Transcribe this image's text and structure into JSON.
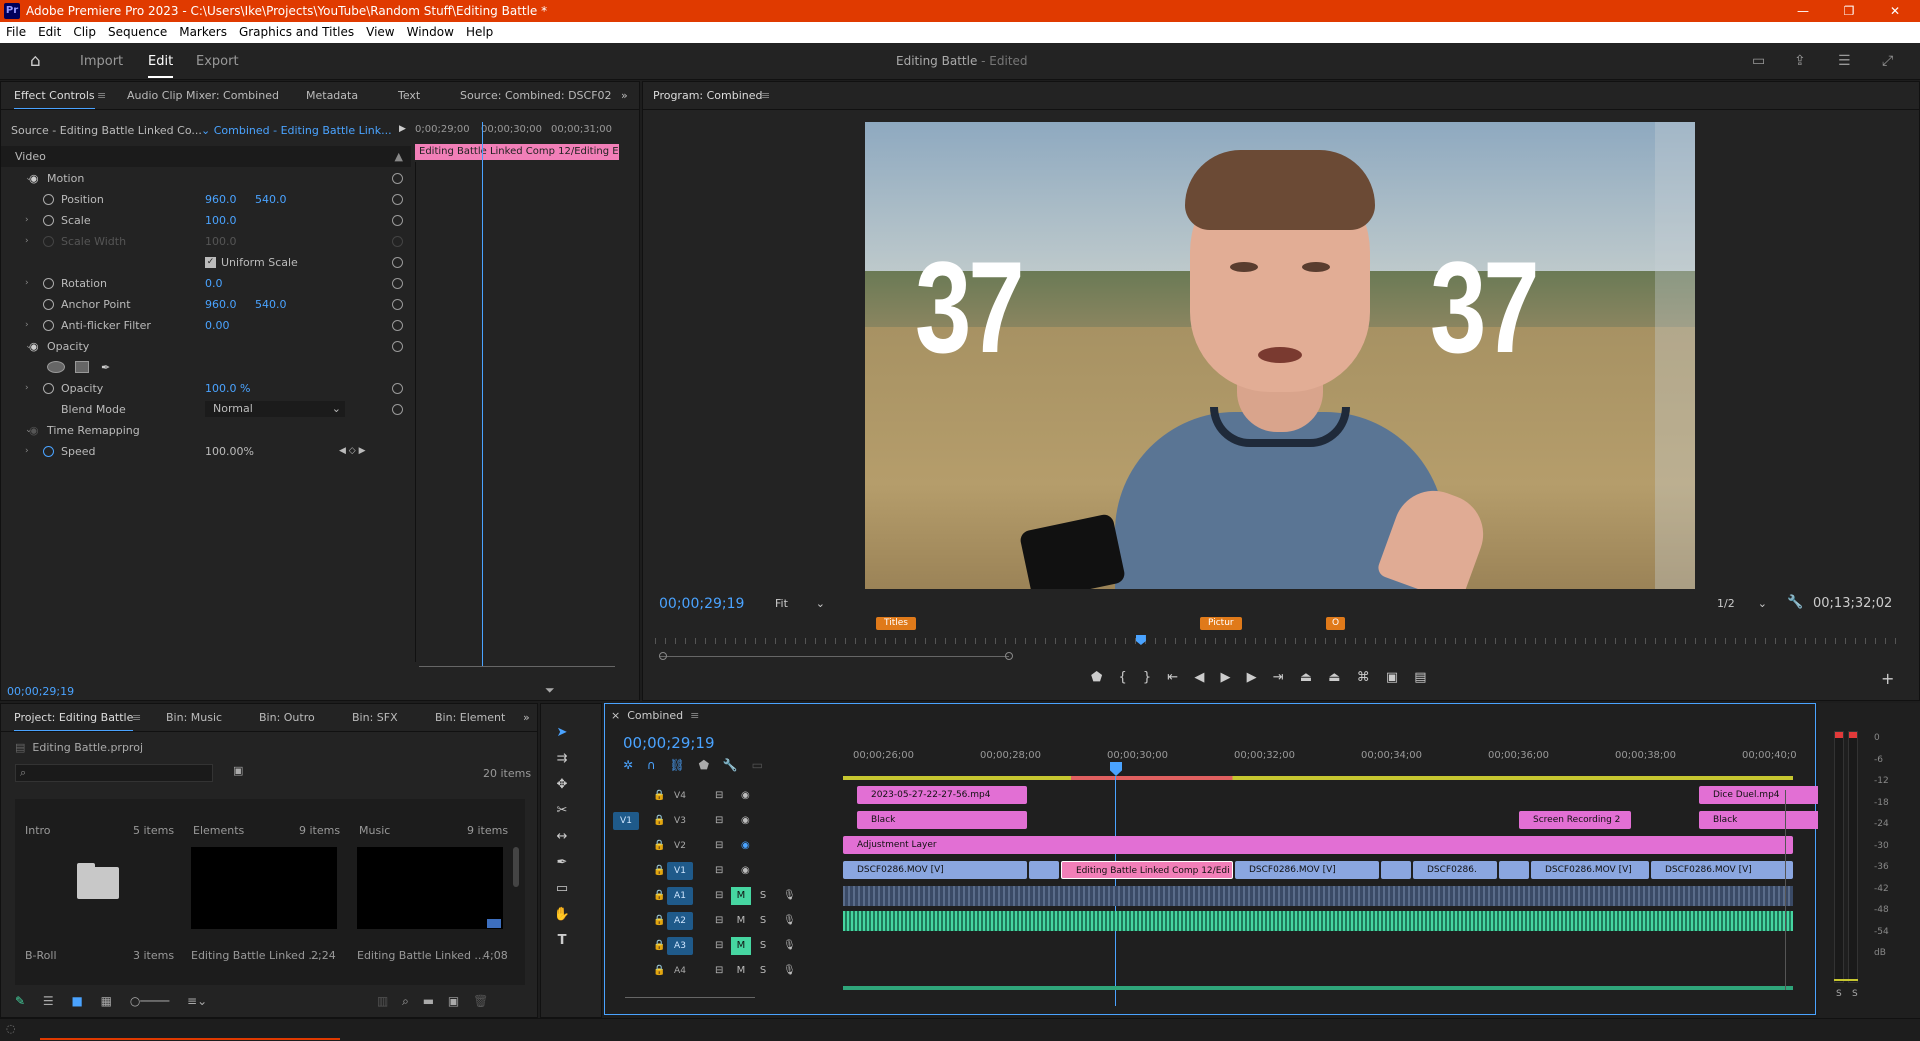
{
  "app": {
    "title": "Adobe Premiere Pro 2023 - C:\\Users\\Ike\\Projects\\YouTube\\Random Stuff\\Editing Battle *",
    "logo": "Pr",
    "window_buttons": [
      "—",
      "❐",
      "✕"
    ]
  },
  "menu": [
    "File",
    "Edit",
    "Clip",
    "Sequence",
    "Markers",
    "Graphics and Titles",
    "View",
    "Window",
    "Help"
  ],
  "workspace": {
    "tabs": [
      "Import",
      "Edit",
      "Export"
    ],
    "active": "Edit",
    "project_title": "Editing Battle",
    "project_status": "- Edited"
  },
  "effect_controls": {
    "tabs": [
      "Effect Controls",
      "Audio Clip Mixer: Combined",
      "Metadata",
      "Text",
      "Source: Combined: DSCF02"
    ],
    "source_label": "Source - Editing Battle Linked Co...",
    "sequence_label": "Combined - Editing Battle Link...",
    "ruler": [
      "0;00;29;00",
      "00;00;30;00",
      "00;00;31;00"
    ],
    "clip_label": "Editing Battle Linked Comp 12/Editing E",
    "section_video": "Video",
    "motion": "Motion",
    "rows": [
      {
        "name": "Position",
        "v1": "960.0",
        "v2": "540.0"
      },
      {
        "name": "Scale",
        "v1": "100.0",
        "v2": ""
      },
      {
        "name": "Scale Width",
        "v1": "100.0",
        "v2": ""
      },
      {
        "name": "Uniform Scale",
        "v1": "",
        "v2": ""
      },
      {
        "name": "Rotation",
        "v1": "0.0",
        "v2": ""
      },
      {
        "name": "Anchor Point",
        "v1": "960.0",
        "v2": "540.0"
      },
      {
        "name": "Anti-flicker Filter",
        "v1": "0.00",
        "v2": ""
      }
    ],
    "opacity_section": "Opacity",
    "opacity_name": "Opacity",
    "opacity_value": "100.0 %",
    "blend_mode_label": "Blend Mode",
    "blend_mode_value": "Normal",
    "time_remapping": "Time Remapping",
    "speed_label": "Speed",
    "speed_value": "100.00%",
    "timecode": "00;00;29;19"
  },
  "program": {
    "title": "Program: Combined",
    "overlay_left": "37",
    "overlay_right": "37",
    "timecode": "00;00;29;19",
    "fit": "Fit",
    "resolution": "1/2",
    "duration": "00;13;32;02",
    "markers": [
      "Titles",
      "Pictur",
      "O"
    ],
    "playhead_fraction": 0.39
  },
  "project": {
    "tabs": [
      "Project: Editing Battle",
      "Bin: Music",
      "Bin: Outro",
      "Bin: SFX",
      "Bin: Element"
    ],
    "file": "Editing Battle.prproj",
    "items_count": "20 items",
    "bins": [
      {
        "name": "Intro",
        "count": "5 items"
      },
      {
        "name": "Elements",
        "count": "9 items"
      },
      {
        "name": "Music",
        "count": "9 items"
      }
    ],
    "bin_broll": {
      "name": "B-Roll",
      "count": "3 items"
    },
    "clips": [
      {
        "name": "Editing Battle Linked ...",
        "dur": "2;24"
      },
      {
        "name": "Editing Battle Linked ...",
        "dur": "4;08"
      }
    ]
  },
  "timeline": {
    "title": "Combined",
    "timecode": "00;00;29;19",
    "ruler": [
      "00;00;26;00",
      "00;00;28;00",
      "00;00;30;00",
      "00;00;32;00",
      "00;00;34;00",
      "00;00;36;00",
      "00;00;38;00",
      "00;00;40;0"
    ],
    "tracks_video": [
      "V4",
      "V3",
      "V2",
      "V1"
    ],
    "tracks_audio": [
      "A1",
      "A2",
      "A3",
      "A4"
    ],
    "source_patch_v": "V1",
    "mute_label": "M",
    "solo_label": "S",
    "clips": {
      "v4a": "2023-05-27-22-27-56.mp4",
      "v4b": "Dice Duel.mp4",
      "v3a": "Black",
      "v3b": "Screen Recording 2",
      "v3c": "Black",
      "v2": "Adjustment Layer",
      "v1a": "DSCF0286.MOV [V]",
      "v1b": "Editing Battle Linked Comp 12/Edi",
      "v1c": "DSCF0286.MOV [V]",
      "v1d": "DSCF0286.",
      "v1e": "DSCF0286.MOV [V]",
      "v1f": "DSCF0286.MOV [V]"
    }
  },
  "meter": {
    "scale": [
      "0",
      "-6",
      "-12",
      "-18",
      "-24",
      "-30",
      "-36",
      "-42",
      "-48",
      "-54",
      "dB"
    ],
    "solo": [
      "S",
      "S"
    ]
  },
  "colors": {
    "accent": "#4aa3ff",
    "title_bar": "#e03a00",
    "clip_pink": "#e26fd4",
    "clip_blue": "#8aa6e0",
    "audio_green": "#46d6a1"
  }
}
